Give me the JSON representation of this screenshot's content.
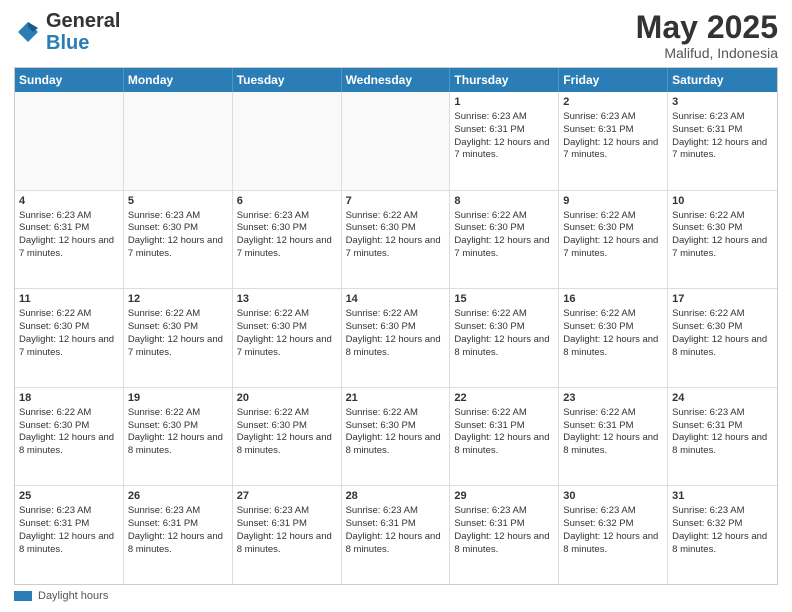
{
  "header": {
    "logo_general": "General",
    "logo_blue": "Blue",
    "title": "May 2025",
    "location": "Malifud, Indonesia"
  },
  "calendar": {
    "days_of_week": [
      "Sunday",
      "Monday",
      "Tuesday",
      "Wednesday",
      "Thursday",
      "Friday",
      "Saturday"
    ],
    "footer_label": "Daylight hours",
    "weeks": [
      [
        {
          "day": "",
          "sunrise": "",
          "sunset": "",
          "daylight": "",
          "empty": true
        },
        {
          "day": "",
          "sunrise": "",
          "sunset": "",
          "daylight": "",
          "empty": true
        },
        {
          "day": "",
          "sunrise": "",
          "sunset": "",
          "daylight": "",
          "empty": true
        },
        {
          "day": "",
          "sunrise": "",
          "sunset": "",
          "daylight": "",
          "empty": true
        },
        {
          "day": "1",
          "sunrise": "Sunrise: 6:23 AM",
          "sunset": "Sunset: 6:31 PM",
          "daylight": "Daylight: 12 hours and 7 minutes."
        },
        {
          "day": "2",
          "sunrise": "Sunrise: 6:23 AM",
          "sunset": "Sunset: 6:31 PM",
          "daylight": "Daylight: 12 hours and 7 minutes."
        },
        {
          "day": "3",
          "sunrise": "Sunrise: 6:23 AM",
          "sunset": "Sunset: 6:31 PM",
          "daylight": "Daylight: 12 hours and 7 minutes."
        }
      ],
      [
        {
          "day": "4",
          "sunrise": "Sunrise: 6:23 AM",
          "sunset": "Sunset: 6:31 PM",
          "daylight": "Daylight: 12 hours and 7 minutes."
        },
        {
          "day": "5",
          "sunrise": "Sunrise: 6:23 AM",
          "sunset": "Sunset: 6:30 PM",
          "daylight": "Daylight: 12 hours and 7 minutes."
        },
        {
          "day": "6",
          "sunrise": "Sunrise: 6:23 AM",
          "sunset": "Sunset: 6:30 PM",
          "daylight": "Daylight: 12 hours and 7 minutes."
        },
        {
          "day": "7",
          "sunrise": "Sunrise: 6:22 AM",
          "sunset": "Sunset: 6:30 PM",
          "daylight": "Daylight: 12 hours and 7 minutes."
        },
        {
          "day": "8",
          "sunrise": "Sunrise: 6:22 AM",
          "sunset": "Sunset: 6:30 PM",
          "daylight": "Daylight: 12 hours and 7 minutes."
        },
        {
          "day": "9",
          "sunrise": "Sunrise: 6:22 AM",
          "sunset": "Sunset: 6:30 PM",
          "daylight": "Daylight: 12 hours and 7 minutes."
        },
        {
          "day": "10",
          "sunrise": "Sunrise: 6:22 AM",
          "sunset": "Sunset: 6:30 PM",
          "daylight": "Daylight: 12 hours and 7 minutes."
        }
      ],
      [
        {
          "day": "11",
          "sunrise": "Sunrise: 6:22 AM",
          "sunset": "Sunset: 6:30 PM",
          "daylight": "Daylight: 12 hours and 7 minutes."
        },
        {
          "day": "12",
          "sunrise": "Sunrise: 6:22 AM",
          "sunset": "Sunset: 6:30 PM",
          "daylight": "Daylight: 12 hours and 7 minutes."
        },
        {
          "day": "13",
          "sunrise": "Sunrise: 6:22 AM",
          "sunset": "Sunset: 6:30 PM",
          "daylight": "Daylight: 12 hours and 7 minutes."
        },
        {
          "day": "14",
          "sunrise": "Sunrise: 6:22 AM",
          "sunset": "Sunset: 6:30 PM",
          "daylight": "Daylight: 12 hours and 8 minutes."
        },
        {
          "day": "15",
          "sunrise": "Sunrise: 6:22 AM",
          "sunset": "Sunset: 6:30 PM",
          "daylight": "Daylight: 12 hours and 8 minutes."
        },
        {
          "day": "16",
          "sunrise": "Sunrise: 6:22 AM",
          "sunset": "Sunset: 6:30 PM",
          "daylight": "Daylight: 12 hours and 8 minutes."
        },
        {
          "day": "17",
          "sunrise": "Sunrise: 6:22 AM",
          "sunset": "Sunset: 6:30 PM",
          "daylight": "Daylight: 12 hours and 8 minutes."
        }
      ],
      [
        {
          "day": "18",
          "sunrise": "Sunrise: 6:22 AM",
          "sunset": "Sunset: 6:30 PM",
          "daylight": "Daylight: 12 hours and 8 minutes."
        },
        {
          "day": "19",
          "sunrise": "Sunrise: 6:22 AM",
          "sunset": "Sunset: 6:30 PM",
          "daylight": "Daylight: 12 hours and 8 minutes."
        },
        {
          "day": "20",
          "sunrise": "Sunrise: 6:22 AM",
          "sunset": "Sunset: 6:30 PM",
          "daylight": "Daylight: 12 hours and 8 minutes."
        },
        {
          "day": "21",
          "sunrise": "Sunrise: 6:22 AM",
          "sunset": "Sunset: 6:30 PM",
          "daylight": "Daylight: 12 hours and 8 minutes."
        },
        {
          "day": "22",
          "sunrise": "Sunrise: 6:22 AM",
          "sunset": "Sunset: 6:31 PM",
          "daylight": "Daylight: 12 hours and 8 minutes."
        },
        {
          "day": "23",
          "sunrise": "Sunrise: 6:22 AM",
          "sunset": "Sunset: 6:31 PM",
          "daylight": "Daylight: 12 hours and 8 minutes."
        },
        {
          "day": "24",
          "sunrise": "Sunrise: 6:23 AM",
          "sunset": "Sunset: 6:31 PM",
          "daylight": "Daylight: 12 hours and 8 minutes."
        }
      ],
      [
        {
          "day": "25",
          "sunrise": "Sunrise: 6:23 AM",
          "sunset": "Sunset: 6:31 PM",
          "daylight": "Daylight: 12 hours and 8 minutes."
        },
        {
          "day": "26",
          "sunrise": "Sunrise: 6:23 AM",
          "sunset": "Sunset: 6:31 PM",
          "daylight": "Daylight: 12 hours and 8 minutes."
        },
        {
          "day": "27",
          "sunrise": "Sunrise: 6:23 AM",
          "sunset": "Sunset: 6:31 PM",
          "daylight": "Daylight: 12 hours and 8 minutes."
        },
        {
          "day": "28",
          "sunrise": "Sunrise: 6:23 AM",
          "sunset": "Sunset: 6:31 PM",
          "daylight": "Daylight: 12 hours and 8 minutes."
        },
        {
          "day": "29",
          "sunrise": "Sunrise: 6:23 AM",
          "sunset": "Sunset: 6:31 PM",
          "daylight": "Daylight: 12 hours and 8 minutes."
        },
        {
          "day": "30",
          "sunrise": "Sunrise: 6:23 AM",
          "sunset": "Sunset: 6:32 PM",
          "daylight": "Daylight: 12 hours and 8 minutes."
        },
        {
          "day": "31",
          "sunrise": "Sunrise: 6:23 AM",
          "sunset": "Sunset: 6:32 PM",
          "daylight": "Daylight: 12 hours and 8 minutes."
        }
      ]
    ]
  }
}
